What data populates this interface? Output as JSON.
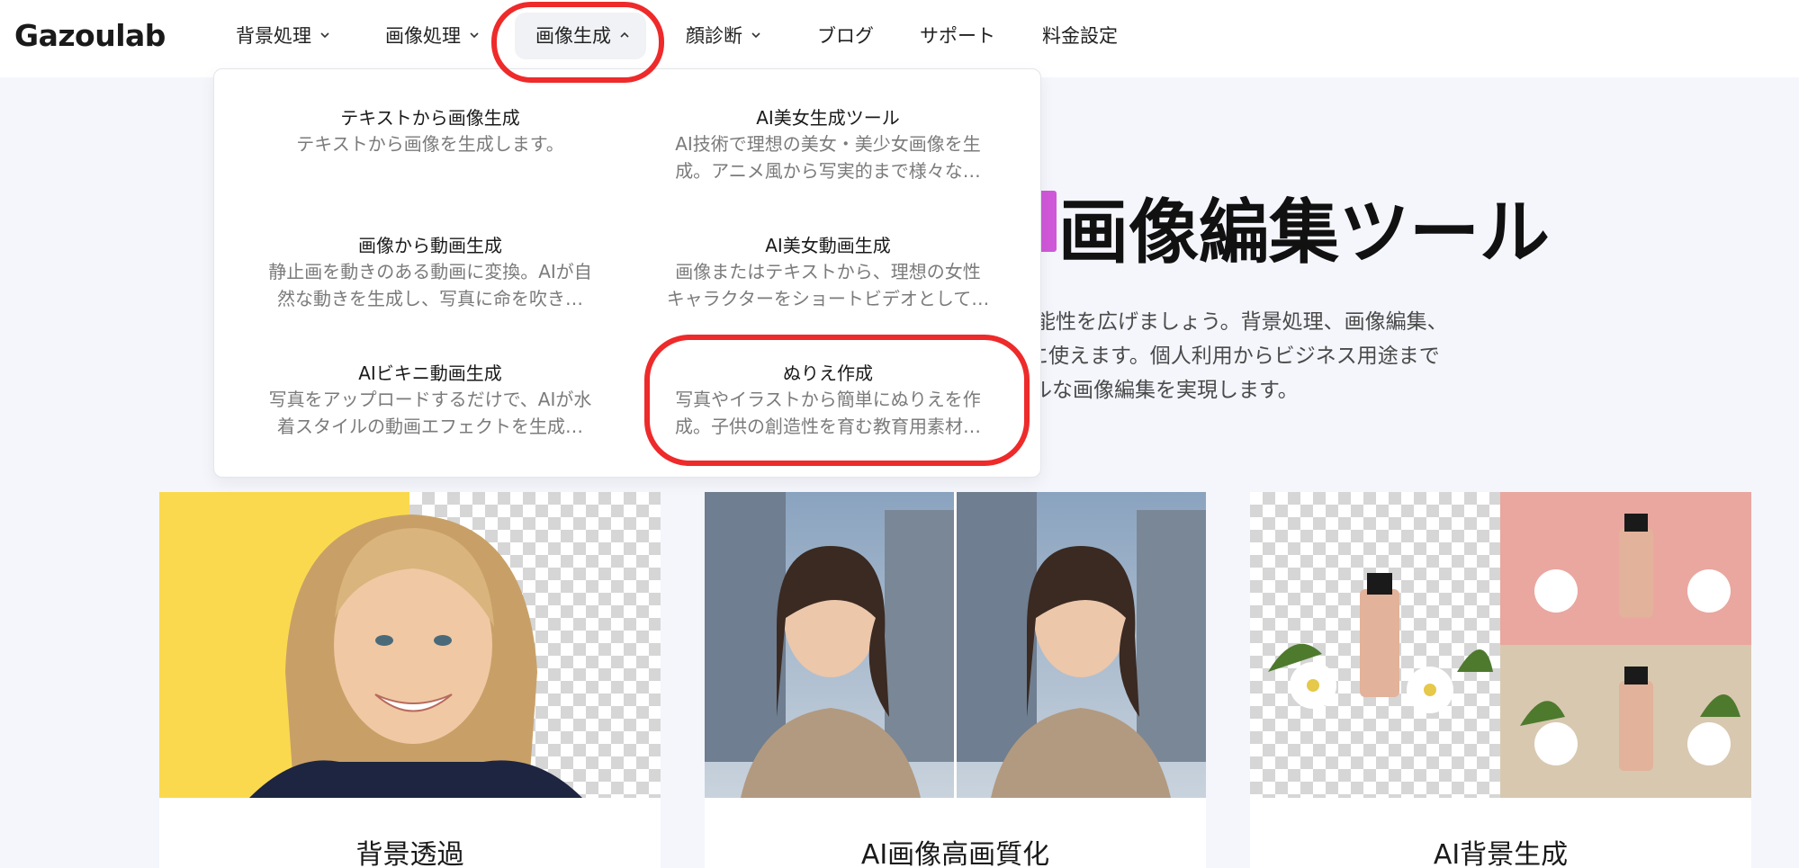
{
  "brand": {
    "logo": "Gazoulab"
  },
  "nav": {
    "items": [
      {
        "label": "背景処理",
        "has_dropdown": true,
        "open": false
      },
      {
        "label": "画像処理",
        "has_dropdown": true,
        "open": false
      },
      {
        "label": "画像生成",
        "has_dropdown": true,
        "open": true
      },
      {
        "label": "顔診断",
        "has_dropdown": true,
        "open": false
      },
      {
        "label": "ブログ",
        "has_dropdown": false
      },
      {
        "label": "サポート",
        "has_dropdown": false
      },
      {
        "label": "料金設定",
        "has_dropdown": false
      }
    ]
  },
  "dropdown": {
    "items": [
      {
        "title": "テキストから画像生成",
        "desc_lines": [
          "テキストから画像を生成します。"
        ]
      },
      {
        "title": "AI美女生成ツール",
        "desc_lines": [
          "AI技術で理想の美女・美少女画像を生",
          "成。アニメ風から写実的まで様々な…"
        ]
      },
      {
        "title": "画像から動画生成",
        "desc_lines": [
          "静止画を動きのある動画に変換。AIが自",
          "然な動きを生成し、写真に命を吹き…"
        ]
      },
      {
        "title": "AI美女動画生成",
        "desc_lines": [
          "画像またはテキストから、理想の女性",
          "キャラクターをショートビデオとして…"
        ]
      },
      {
        "title": "AIビキニ動画生成",
        "desc_lines": [
          "写真をアップロードするだけで、AIが水",
          "着スタイルの動画エフェクトを生成…"
        ]
      },
      {
        "title": "ぬりえ作成",
        "desc_lines": [
          "写真やイラストから簡単にぬりえを作",
          "成。子供の創造性を育む教育用素材…"
        ]
      }
    ]
  },
  "hero": {
    "title_visible": "画像編集ツール",
    "desc_lines": [
      "能性を広げましょう。背景処理、画像編集、",
      "に使えます。個人利用からビジネス用途まで",
      "ルな画像編集を実現します。"
    ]
  },
  "cards": [
    {
      "title": "背景透過"
    },
    {
      "title": "AI画像高画質化"
    },
    {
      "title": "AI背景生成"
    }
  ],
  "colors": {
    "highlight": "#ee2a2a",
    "accent": "#cf58d9",
    "background": "#f4f6fc"
  }
}
